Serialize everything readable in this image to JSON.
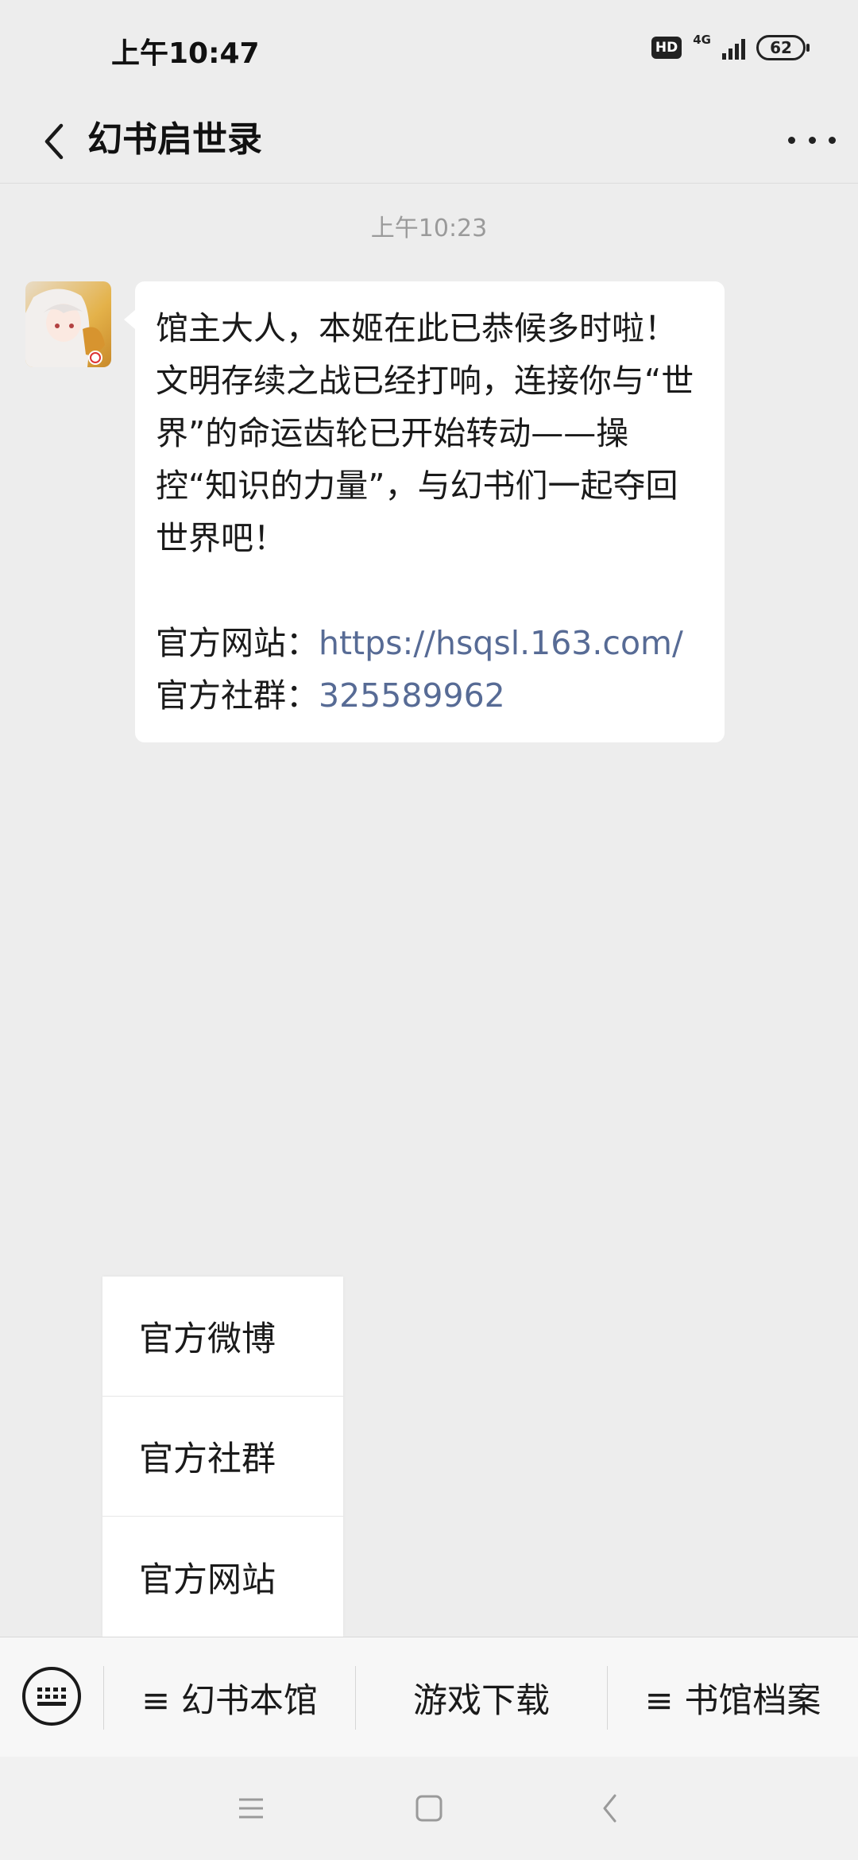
{
  "status_bar": {
    "time": "上午10:47",
    "hd": "HD",
    "network": "4G",
    "battery": "62"
  },
  "nav": {
    "title": "幻书启世录"
  },
  "chat": {
    "timestamp": "上午10:23",
    "message": {
      "lines": [
        "馆主大人，本姬在此已恭候多时啦！文明存续之战已经打响，连接你与“世界”的命运齿轮已开始转动——操控“知识的力量”，与幻书们一起夺回世界吧！"
      ],
      "website_label": "官方网站：",
      "website_url": "https://hsqsl.163.com/",
      "community_label": "官方社群：",
      "community_id": "325589962"
    }
  },
  "popup_menu": {
    "items": [
      "官方微博",
      "官方社群",
      "官方网站"
    ]
  },
  "menu_bar": {
    "items": [
      "≡ 幻书本馆",
      "游戏下载",
      "≡ 书馆档案"
    ]
  }
}
